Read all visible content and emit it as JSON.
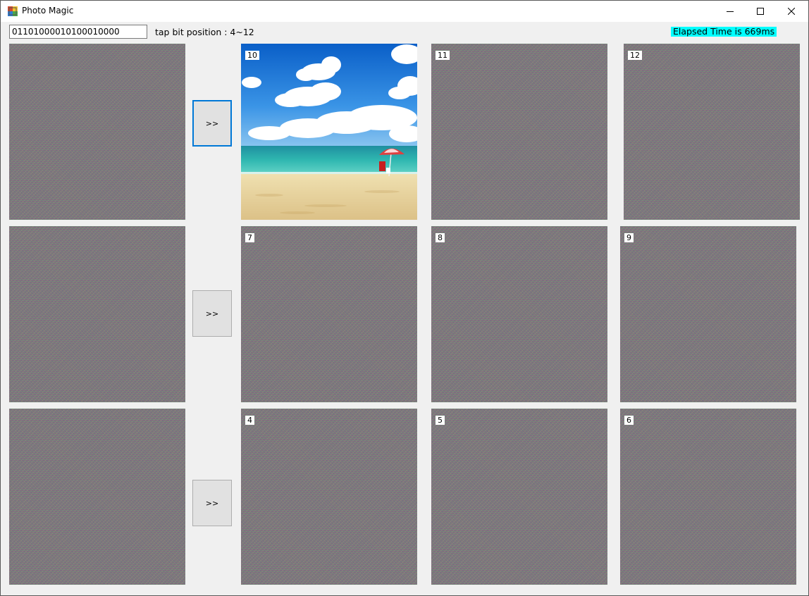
{
  "window": {
    "title": "Photo Magic",
    "icons": [
      "app-icon",
      "minimize-icon",
      "maximize-icon",
      "close-icon"
    ]
  },
  "toolbar": {
    "bit_sequence": "01101000010100010000",
    "tap_label": "tap bit position : 4~12",
    "elapsed_label": "Elapsed Time is 669ms",
    "elapsed_bg": "#00ffff"
  },
  "buttons": [
    {
      "label": ">>"
    },
    {
      "label": ">>"
    },
    {
      "label": ">>"
    }
  ],
  "tiles": {
    "row1": [
      "10",
      "11",
      "12"
    ],
    "row2": [
      "7",
      "8",
      "9"
    ],
    "row3": [
      "4",
      "5",
      "6"
    ]
  },
  "colors": {
    "focus_border": "#0078d7",
    "noise_base": "#7c7878"
  }
}
